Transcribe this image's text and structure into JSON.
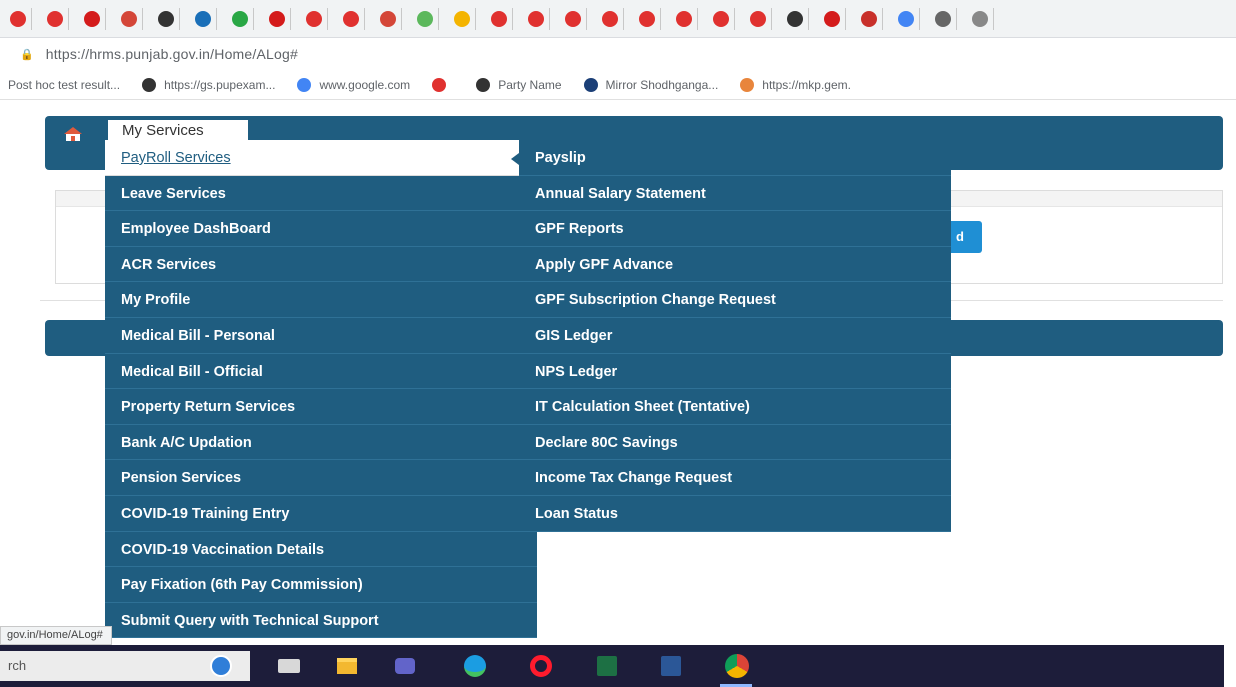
{
  "browser": {
    "url": "https://hrms.punjab.gov.in/Home/ALog#",
    "tabs": [
      {
        "icon": "red-app-icon",
        "color": "#e0312f"
      },
      {
        "icon": "red-app-icon",
        "color": "#e0312f"
      },
      {
        "icon": "red-flag-icon",
        "color": "#d41b1b"
      },
      {
        "icon": "gmail-icon",
        "color": "#d44638"
      },
      {
        "icon": "github-icon",
        "color": "#333333"
      },
      {
        "icon": "blue-square-icon",
        "color": "#1a6fb8"
      },
      {
        "icon": "green-circle-icon",
        "color": "#29a745"
      },
      {
        "icon": "red-flag-icon",
        "color": "#d41b1b"
      },
      {
        "icon": "red-app-icon",
        "color": "#e0312f"
      },
      {
        "icon": "red-app-icon",
        "color": "#e0312f"
      },
      {
        "icon": "gmail-icon",
        "color": "#d44638"
      },
      {
        "icon": "green-square-icon",
        "color": "#5cb85c"
      },
      {
        "icon": "multicolor-square-icon",
        "color": "#f4b400"
      },
      {
        "icon": "red-app-icon",
        "color": "#e0312f"
      },
      {
        "icon": "red-app-icon",
        "color": "#e0312f"
      },
      {
        "icon": "red-app-icon",
        "color": "#e0312f"
      },
      {
        "icon": "red-app-icon",
        "color": "#e0312f"
      },
      {
        "icon": "red-app-icon",
        "color": "#e0312f"
      },
      {
        "icon": "red-app-icon",
        "color": "#e0312f"
      },
      {
        "icon": "red-app-icon",
        "color": "#e0312f"
      },
      {
        "icon": "red-app-icon",
        "color": "#e0312f"
      },
      {
        "icon": "github-icon",
        "color": "#333333"
      },
      {
        "icon": "red-flag-icon",
        "color": "#d41b1b"
      },
      {
        "icon": "red-oval-icon",
        "color": "#c8302a"
      },
      {
        "icon": "google-icon",
        "color": "#4285f4"
      },
      {
        "icon": "text-icon",
        "color": "#666666"
      },
      {
        "icon": "ellipsis-icon",
        "color": "#888888"
      }
    ],
    "bookmarks": [
      {
        "label": "Post hoc test result...",
        "icon": "none"
      },
      {
        "label": "https://gs.pupexam...",
        "icon": "github-icon"
      },
      {
        "label": "www.google.com",
        "icon": "google-icon"
      },
      {
        "label": "",
        "icon": "red-app-icon"
      },
      {
        "label": "Party Name",
        "icon": "github-icon"
      },
      {
        "label": "Mirror Shodhganga...",
        "icon": "shodhganga-icon"
      },
      {
        "label": "https://mkp.gem.",
        "icon": "gem-icon"
      }
    ]
  },
  "nav": {
    "my_services": "My Services"
  },
  "menu": {
    "left": [
      "PayRoll Services",
      "Leave Services",
      "Employee DashBoard",
      "ACR Services",
      "My Profile",
      "Medical Bill - Personal",
      "Medical Bill - Official",
      "Property Return Services",
      "Bank A/C Updation",
      "Pension Services",
      "COVID-19 Training Entry",
      "COVID-19 Vaccination Details",
      "Pay Fixation (6th Pay Commission)",
      "Submit Query with Technical Support"
    ],
    "right": [
      "Payslip",
      "Annual Salary Statement",
      "GPF Reports",
      "Apply GPF Advance",
      "GPF Subscription Change Request",
      "GIS Ledger",
      "NPS Ledger",
      "IT Calculation Sheet (Tentative)",
      "Declare 80C Savings",
      "Income Tax Change Request",
      "Loan Status"
    ]
  },
  "panel": {
    "button_label": "d"
  },
  "status_url": "gov.in/Home/ALog#",
  "taskbar": {
    "search_placeholder": "rch"
  },
  "colors": {
    "menu_bg": "#1f5d80",
    "accent": "#1f8fd4"
  }
}
